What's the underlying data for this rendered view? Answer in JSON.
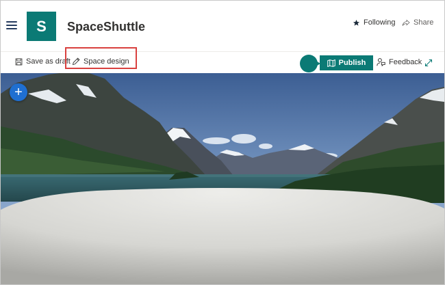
{
  "site": {
    "logo_letter": "S",
    "title": "SpaceShuttle"
  },
  "header_actions": {
    "following_label": "Following",
    "share_label": "Share"
  },
  "toolbar": {
    "save_label": "Save as draft",
    "design_label": "Space design",
    "publish_label": "Publish",
    "feedback_label": "Feedback"
  },
  "icons": {
    "menu": "hamburger-icon",
    "following": "star-icon",
    "share": "share-icon",
    "save": "save-icon",
    "design": "pencil-icon",
    "publish": "map-icon",
    "feedback": "feedback-icon",
    "expand": "expand-icon",
    "add": "plus-icon"
  },
  "colors": {
    "brand": "#0b7a75",
    "highlight": "#d9403e",
    "add_button": "#1f6fd1"
  },
  "canvas": {
    "add_glyph": "+"
  }
}
